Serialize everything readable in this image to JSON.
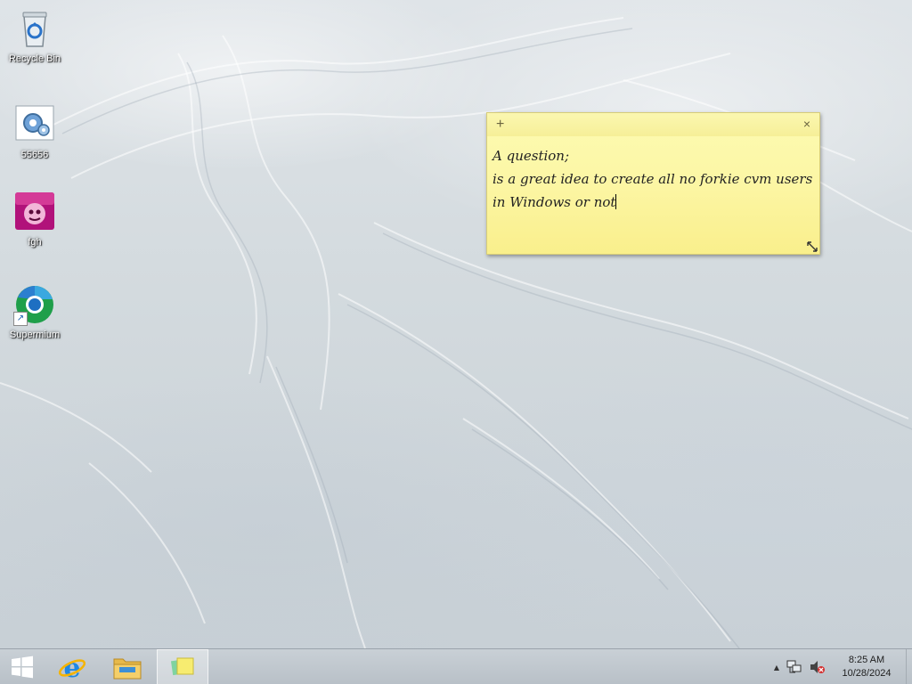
{
  "desktop": {
    "icons": [
      {
        "id": "recycle-bin",
        "label": "Recycle Bin",
        "icon": "recycle-bin-icon"
      },
      {
        "id": "55656",
        "label": "55656",
        "icon": "gear-settings-icon"
      },
      {
        "id": "fgh",
        "label": "fgh",
        "icon": "media-app-icon"
      },
      {
        "id": "supermium",
        "label": "Supermium",
        "icon": "supermium-browser-icon",
        "shortcut": true
      }
    ]
  },
  "sticky_note": {
    "add_glyph": "+",
    "close_glyph": "×",
    "lines": [
      "A question;",
      "is a great idea to create all no forkie cvm users",
      "in Windows or not"
    ],
    "color": "#fcf6a4"
  },
  "taskbar": {
    "pinned": [
      {
        "name": "start-button",
        "icon": "windows-logo-icon"
      },
      {
        "name": "internet-explorer",
        "icon": "internet-explorer-icon"
      },
      {
        "name": "file-explorer",
        "icon": "folder-icon"
      },
      {
        "name": "sticky-notes",
        "icon": "sticky-notes-icon",
        "active": true
      }
    ],
    "tray": {
      "overflow_glyph": "▲",
      "network_icon": "network-icon",
      "volume_icon": "volume-muted-icon"
    },
    "clock": {
      "time": "8:25 AM",
      "date": "10/28/2024"
    }
  }
}
